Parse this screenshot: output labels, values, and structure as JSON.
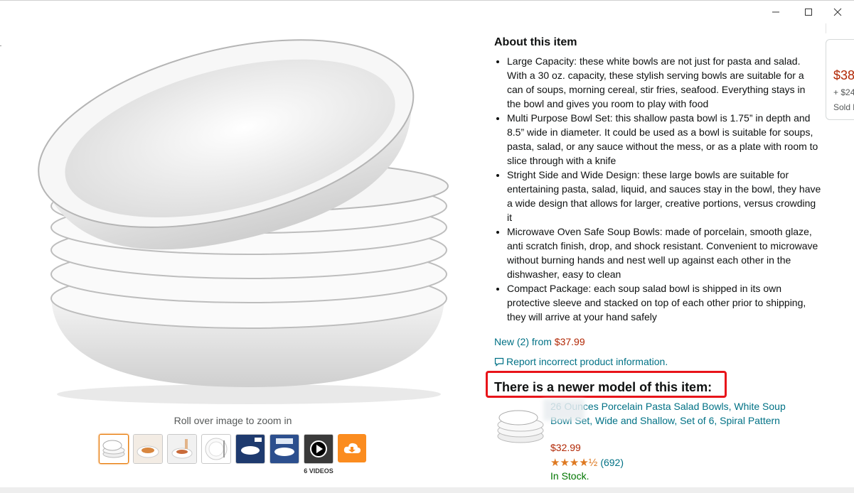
{
  "window": {
    "minimize_icon": "minimize-icon",
    "maximize_icon": "maximize-icon",
    "close_icon": "close-icon"
  },
  "gallery": {
    "zoom_hint": "Roll over image to zoom in",
    "videos_label": "6 VIDEOS",
    "thumbnail_count": 7
  },
  "about": {
    "title": "About this item",
    "bullets": [
      "Large Capacity: these white bowls are not just for pasta and salad. With a 30 oz. capacity, these stylish serving bowls are suitable for a can of soups, morning cereal, stir fries, seafood. Everything stays in the bowl and gives you room to play with food",
      "Multi Purpose Bowl Set: this shallow pasta bowl is 1.75” in depth and 8.5” wide in diameter. It could be used as a bowl is suitable for soups, pasta, salad, or any sauce without the mess, or as a plate with room to slice through with a knife",
      "Stright Side and Wide Design: these large bowls are suitable for entertaining pasta, salad, liquid, and sauces stay in the bowl, they have a wide design that allows for larger, creative portions, versus crowding it",
      "Microwave Oven Safe Soup Bowls: made of porcelain, smooth glaze, anti scratch finish, drop, and shock resistant. Convenient to microwave without burning hands and nest well up against each other in the dishwasher, easy to clean",
      "Compact Package: each soup salad bowl is shipped in its own protective sleeve and stacked on top of each other prior to shipping, they will arrive at your hand safely"
    ]
  },
  "offers": {
    "new_label": "New (2) from ",
    "new_price": "$37.99"
  },
  "report": {
    "label": "Report incorrect product information."
  },
  "newer_model": {
    "heading": "There is a newer model of this item:",
    "product_link": "26 Ounces Porcelain Pasta Salad Bowls, White Soup Bowl Set, Wide and Shallow, Set of 6, Spiral Pattern",
    "price": "$32.99",
    "stars": "★★★★½",
    "rating": 4.5,
    "review_count": "(692)",
    "availability": "In Stock."
  },
  "side_panel": {
    "price": "$38",
    "shipping": "+ $24",
    "sold": "Sold b"
  },
  "colors": {
    "link": "#007185",
    "price": "#b12704",
    "in_stock": "#007600",
    "highlight_box": "#e8141a",
    "star": "#de7921",
    "download_button": "#fb8c1f"
  }
}
